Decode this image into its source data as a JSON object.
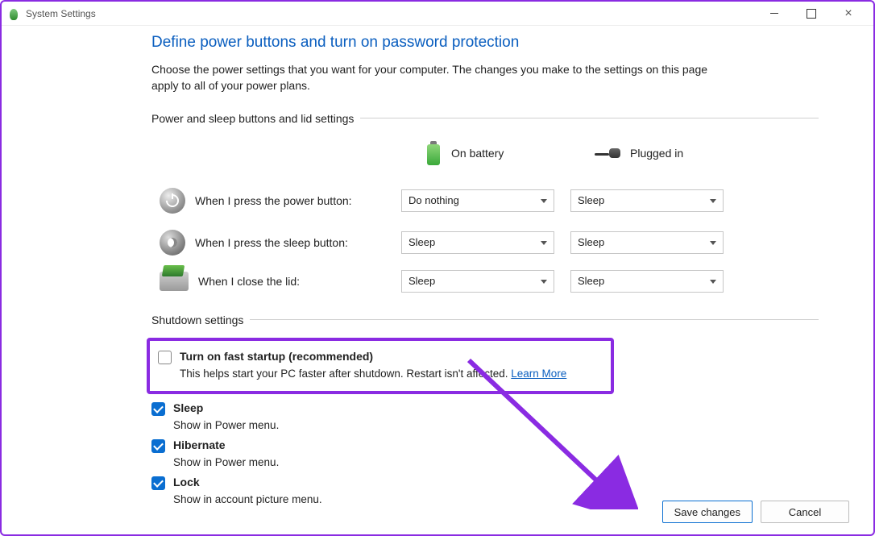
{
  "window": {
    "title": "System Settings"
  },
  "heading": "Define power buttons and turn on password protection",
  "description": "Choose the power settings that you want for your computer. The changes you make to the settings on this page apply to all of your power plans.",
  "section1": {
    "title": "Power and sleep buttons and lid settings",
    "col_battery": "On battery",
    "col_plugged": "Plugged in",
    "rows": [
      {
        "label": "When I press the power button:",
        "battery": "Do nothing",
        "plugged": "Sleep"
      },
      {
        "label": "When I press the sleep button:",
        "battery": "Sleep",
        "plugged": "Sleep"
      },
      {
        "label": "When I close the lid:",
        "battery": "Sleep",
        "plugged": "Sleep"
      }
    ]
  },
  "section2": {
    "title": "Shutdown settings",
    "items": [
      {
        "label": "Turn on fast startup (recommended)",
        "desc": "This helps start your PC faster after shutdown. Restart isn't affected.",
        "link": "Learn More",
        "checked": false
      },
      {
        "label": "Sleep",
        "desc": "Show in Power menu.",
        "checked": true
      },
      {
        "label": "Hibernate",
        "desc": "Show in Power menu.",
        "checked": true
      },
      {
        "label": "Lock",
        "desc": "Show in account picture menu.",
        "checked": true
      }
    ]
  },
  "buttons": {
    "save": "Save changes",
    "cancel": "Cancel"
  }
}
